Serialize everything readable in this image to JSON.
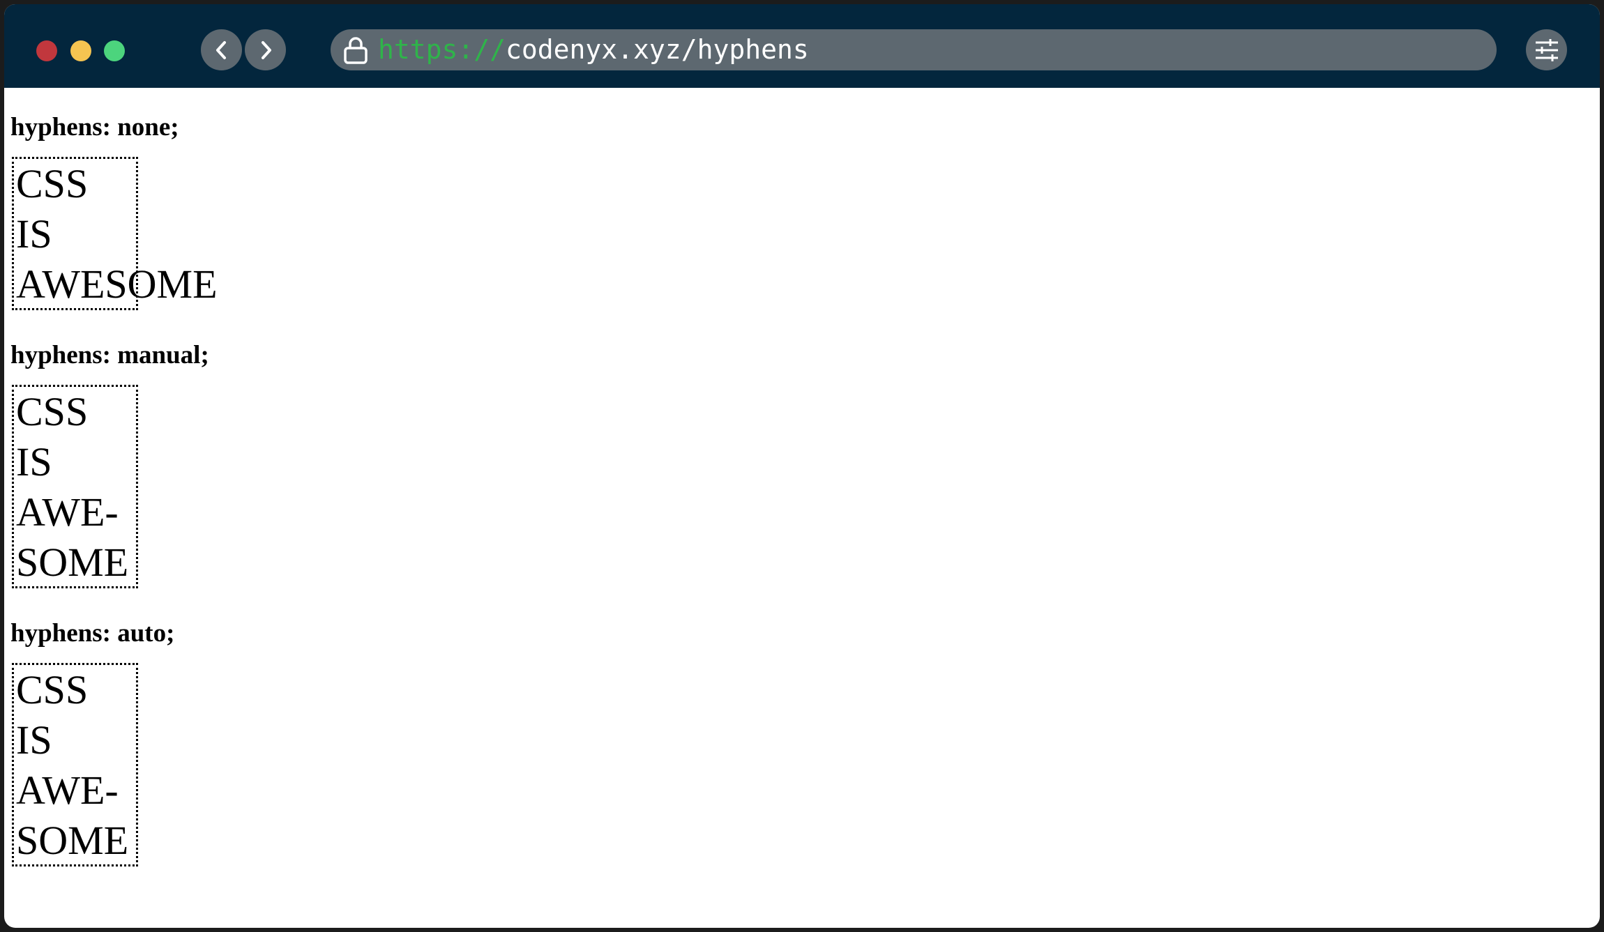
{
  "browser": {
    "url_scheme": "https://",
    "url_rest": "codenyx.xyz/hyphens",
    "icons": {
      "back": "chevron-left-icon",
      "forward": "chevron-right-icon",
      "lock": "lock-icon",
      "settings": "sliders-icon"
    },
    "colors": {
      "titlebar": "#03263d",
      "controls": "#5d6870",
      "scheme": "#2fb44a",
      "close": "#c1373d",
      "minimize": "#f5c451",
      "maximize": "#4cd47d"
    }
  },
  "page": {
    "sections": [
      {
        "heading": "hyphens: none;",
        "lines": [
          "CSS",
          "IS",
          "AWESOME"
        ]
      },
      {
        "heading": "hyphens: manual;",
        "lines": [
          "CSS",
          "IS",
          "AWE-",
          "SOME"
        ]
      },
      {
        "heading": "hyphens: auto;",
        "lines": [
          "CSS",
          "IS",
          "AWE-",
          "SOME"
        ]
      }
    ]
  }
}
